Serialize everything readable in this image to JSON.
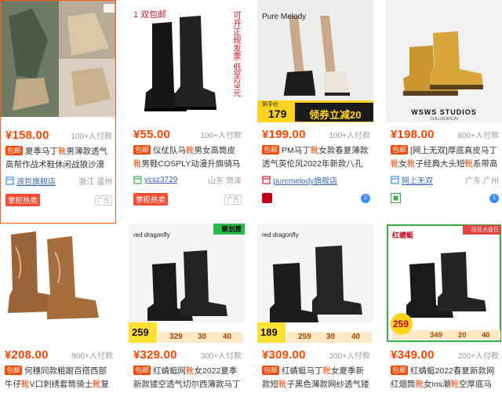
{
  "products": [
    {
      "price": "¥158.00",
      "sales": "100+人付款",
      "title_prefix": "夏季马丁",
      "title_hl": "靴",
      "title_rest": "男薄款透气高帮作战术鞋休闲战狼沙漠工",
      "shop": "浪哲旗舰店",
      "location": "浙江 温州",
      "badge": "掌柜热卖",
      "ad": "广告"
    },
    {
      "overlay": "1 双包邮",
      "vertical_text": "可开正规发票 低至29元",
      "price": "¥55.00",
      "sales": "100+人付款",
      "title_prefix": "仪仗队马",
      "title_hl": "靴",
      "title_rest": "男女高筒皮",
      "title_line2_hl": "靴",
      "title_line2": "男鞋COSPLY动漫升旗骑马",
      "shop": "ycsz3729",
      "location": "山东 菏泽",
      "badge": "掌柜热卖",
      "ad": "广告"
    },
    {
      "brand": "Pure Melody",
      "promo_tag": "到手价",
      "promo_price": "179",
      "promo_text": "领券立减20",
      "price": "¥199.00",
      "sales": "100+人付款",
      "title_prefix": "PM马丁",
      "title_hl": "靴",
      "title_rest": "女款春夏薄款透气英伦风2022年新款八孔厚",
      "shop": "puremelody旗舰店",
      "location": ""
    },
    {
      "brand": "WSWS STUDIOS",
      "brand_sub": "COLLOCATION",
      "price": "¥198.00",
      "sales": "800+人付款",
      "title_prefix": "[网上无双]厚底真皮马丁",
      "title_hl": "靴",
      "title_rest": "女",
      "title_line2_hl": "靴",
      "title_line2": "子经典大头短",
      "title_line2_hl2": "靴",
      "title_line2b": "系带高",
      "shop": "网上无双",
      "location": "广东 广州"
    },
    {
      "price": "¥208.00",
      "sales": "900+人付款",
      "title_prefix": "何穗同款粗跟百搭西部牛仔",
      "title_hl": "靴",
      "title_rest": "V口刺绣套筒骑士",
      "title_line2_hl": "靴",
      "title_line2": "复"
    },
    {
      "brand": "red dragonfly",
      "corner": "聚划算",
      "promo_price": "259",
      "promo_a": "329",
      "promo_b": "30",
      "promo_c": "40",
      "price": "¥329.00",
      "sales": "300+人付款",
      "title_prefix": "红蜻蜓网",
      "title_hl": "靴",
      "title_rest": "女2022夏季新款镂空透气切尔西薄款马丁"
    },
    {
      "brand": "red dragonfly",
      "promo_price": "189",
      "promo_a": "259",
      "promo_b": "30",
      "promo_c": "40",
      "price": "¥309.00",
      "sales": "300+人付款",
      "title_prefix": "红蜻蜓马丁",
      "title_hl": "靴",
      "title_rest": "女夏季新款短",
      "title_line2_hl": "靴",
      "title_line2": "子黑色薄款网纱透气镂"
    },
    {
      "brand": "红蜻蜓",
      "corner": "旺旺大促日",
      "promo_price": "259",
      "promo_a": "349",
      "promo_b": "20",
      "promo_c": "40",
      "price": "¥349.00",
      "sales": "200+人付款",
      "title_prefix": "红蜻蜓2022春夏新款网红烟筒",
      "title_hl": "靴",
      "title_rest": "女ins潮",
      "title_line2_hl": "靴",
      "title_line2": "空厚底马丁"
    }
  ],
  "labels": {
    "baoyou": "包邮"
  },
  "colors": {
    "accent": "#ff4400",
    "link": "#3b67b5",
    "hot": "#f54d33"
  }
}
